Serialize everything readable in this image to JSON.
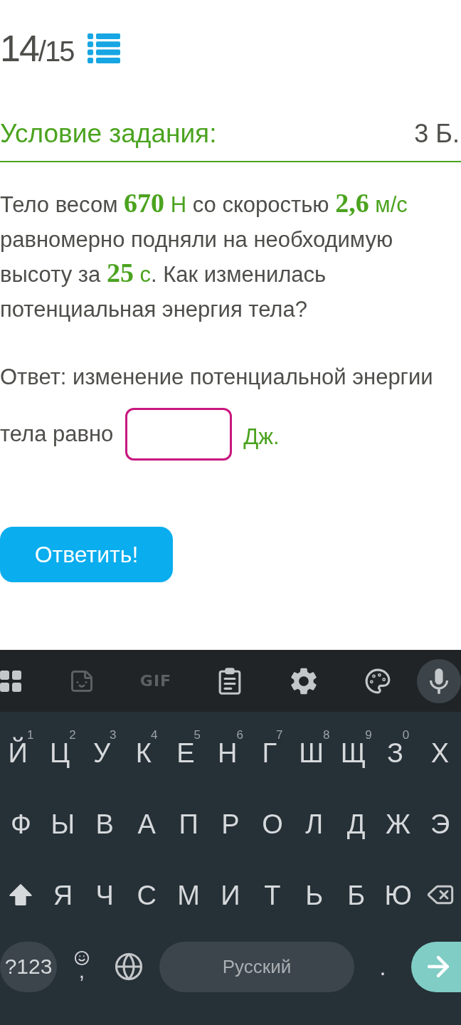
{
  "header": {
    "counter": {
      "current": "14",
      "total": "/15"
    }
  },
  "section": {
    "title": "Условие задания:",
    "points": "3 Б."
  },
  "problem": {
    "segments": [
      {
        "kind": "text",
        "text": "Тело весом "
      },
      {
        "kind": "number",
        "text": "670"
      },
      {
        "kind": "unit",
        "text": " Н"
      },
      {
        "kind": "text",
        "text": " со скоростью "
      },
      {
        "kind": "number",
        "text": "2,6"
      },
      {
        "kind": "unit",
        "text": " м/с"
      },
      {
        "kind": "text",
        "text": " равномерно подняли на необходимую высоту за "
      },
      {
        "kind": "number",
        "text": "25"
      },
      {
        "kind": "unit",
        "text": " с"
      },
      {
        "kind": "text",
        "text": ". Как изменилась потенциальная энергия тела?"
      }
    ]
  },
  "answer": {
    "text_lines": [
      "Ответ: изменение потенциальной энергии",
      "тела равно"
    ],
    "unit": "Дж."
  },
  "submit_button": {
    "label": "Ответить!"
  },
  "keyboard": {
    "shift_on": true,
    "toolbar": [
      {
        "kind": "apps",
        "disabled": false
      },
      {
        "kind": "sticker",
        "disabled": true
      },
      {
        "kind": "gif",
        "label": "GIF",
        "disabled": true
      },
      {
        "kind": "clipboard",
        "disabled": false
      },
      {
        "kind": "settings",
        "disabled": false
      },
      {
        "kind": "palette",
        "disabled": false
      },
      {
        "kind": "mic",
        "disabled": false
      }
    ],
    "letter_rows": [
      [
        {
          "kind": "letter",
          "label": "Й",
          "hint": "1"
        },
        {
          "kind": "letter",
          "label": "Ц",
          "hint": "2"
        },
        {
          "kind": "letter",
          "label": "У",
          "hint": "3"
        },
        {
          "kind": "letter",
          "label": "К",
          "hint": "4"
        },
        {
          "kind": "letter",
          "label": "Е",
          "hint": "5"
        },
        {
          "kind": "letter",
          "label": "Н",
          "hint": "6"
        },
        {
          "kind": "letter",
          "label": "Г",
          "hint": "7"
        },
        {
          "kind": "letter",
          "label": "Ш",
          "hint": "8"
        },
        {
          "kind": "letter",
          "label": "Щ",
          "hint": "9"
        },
        {
          "kind": "letter",
          "label": "З",
          "hint": "0"
        },
        {
          "kind": "letter",
          "label": "Х"
        }
      ],
      [
        {
          "kind": "letter",
          "label": "Ф"
        },
        {
          "kind": "letter",
          "label": "Ы"
        },
        {
          "kind": "letter",
          "label": "В"
        },
        {
          "kind": "letter",
          "label": "А"
        },
        {
          "kind": "letter",
          "label": "П"
        },
        {
          "kind": "letter",
          "label": "Р"
        },
        {
          "kind": "letter",
          "label": "О"
        },
        {
          "kind": "letter",
          "label": "Л"
        },
        {
          "kind": "letter",
          "label": "Д"
        },
        {
          "kind": "letter",
          "label": "Ж"
        },
        {
          "kind": "letter",
          "label": "Э"
        }
      ],
      [
        {
          "kind": "shift"
        },
        {
          "kind": "letter",
          "label": "Я"
        },
        {
          "kind": "letter",
          "label": "Ч"
        },
        {
          "kind": "letter",
          "label": "С"
        },
        {
          "kind": "letter",
          "label": "М"
        },
        {
          "kind": "letter",
          "label": "И"
        },
        {
          "kind": "letter",
          "label": "Т"
        },
        {
          "kind": "letter",
          "label": "Ь"
        },
        {
          "kind": "letter",
          "label": "Б"
        },
        {
          "kind": "letter",
          "label": "Ю"
        },
        {
          "kind": "backspace"
        }
      ]
    ],
    "bottom_row": [
      {
        "kind": "symbols",
        "label": "?123"
      },
      {
        "kind": "emoji_comma",
        "label": ","
      },
      {
        "kind": "language"
      },
      {
        "kind": "space",
        "label": "Русский"
      },
      {
        "kind": "period",
        "label": "."
      },
      {
        "kind": "enter"
      }
    ]
  }
}
